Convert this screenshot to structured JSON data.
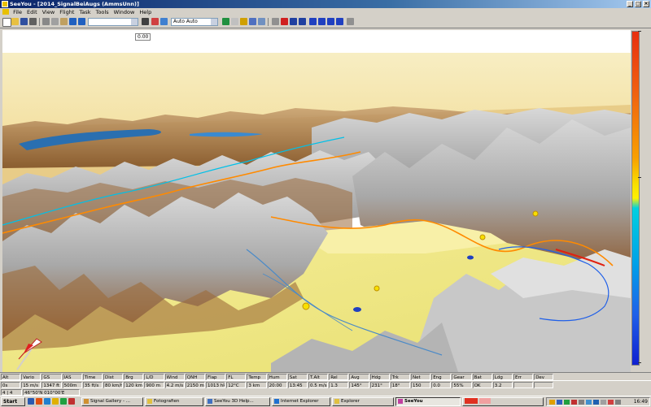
{
  "window": {
    "title": "SeeYou - [2014_SignalBeiAugs (AmmsUnn)]",
    "minimize": "_",
    "maximize": "□",
    "close": "×"
  },
  "menu": {
    "items": [
      "File",
      "Edit",
      "View",
      "Flight",
      "Task",
      "Tools",
      "Window",
      "Help"
    ]
  },
  "toolbar": {
    "zoom_combo": "",
    "mode_combo": "Auto Auto"
  },
  "viewport": {
    "label": "0.00"
  },
  "status": {
    "row1": [
      "Alt",
      "Vario",
      "GS",
      "IAS",
      "Time",
      "Dist",
      "Brg",
      "L/D",
      "Wind",
      "QNH",
      "Flap",
      "FL",
      "Temp",
      "Hum",
      "Sat",
      "T.Alt",
      "Rel",
      "Avg",
      "Hdg",
      "Trk",
      "Net",
      "Eng",
      "Gear",
      "Bat",
      "Ldg",
      "Err",
      "Dev"
    ],
    "row2": [
      "0s",
      "15 m/s",
      "1347 ft",
      "500m",
      "35 ft/s",
      "80 km/h",
      "120 km/h",
      "900 m",
      "4.2 m/s",
      "2150 m",
      "1013 hPa",
      "12°C",
      "3 km",
      "20:00",
      "13:45",
      "0.5 m/s",
      "1.3",
      "145°",
      "231°",
      "18°",
      "150",
      "0.0",
      "55%",
      "OK",
      "3.2",
      "",
      ""
    ],
    "row3_left": "4 | 4",
    "row3_coords": "46°50'N 010°00'E"
  },
  "taskbar": {
    "start": "Start",
    "tasks": [
      "Signal Gallery - ...",
      "Fotografien",
      "SeeYou 3D Help...",
      "Internet Explorer",
      "SeeYou",
      "Explorer"
    ],
    "clock": "16:49"
  },
  "colors": {
    "sky": "#f6e4a0",
    "terrain_high": "#b8b8b8",
    "terrain_mid": "#a8743c",
    "valley": "#f2ea90",
    "lake": "#2a6fb0",
    "flight_track": "#ff8a00"
  }
}
